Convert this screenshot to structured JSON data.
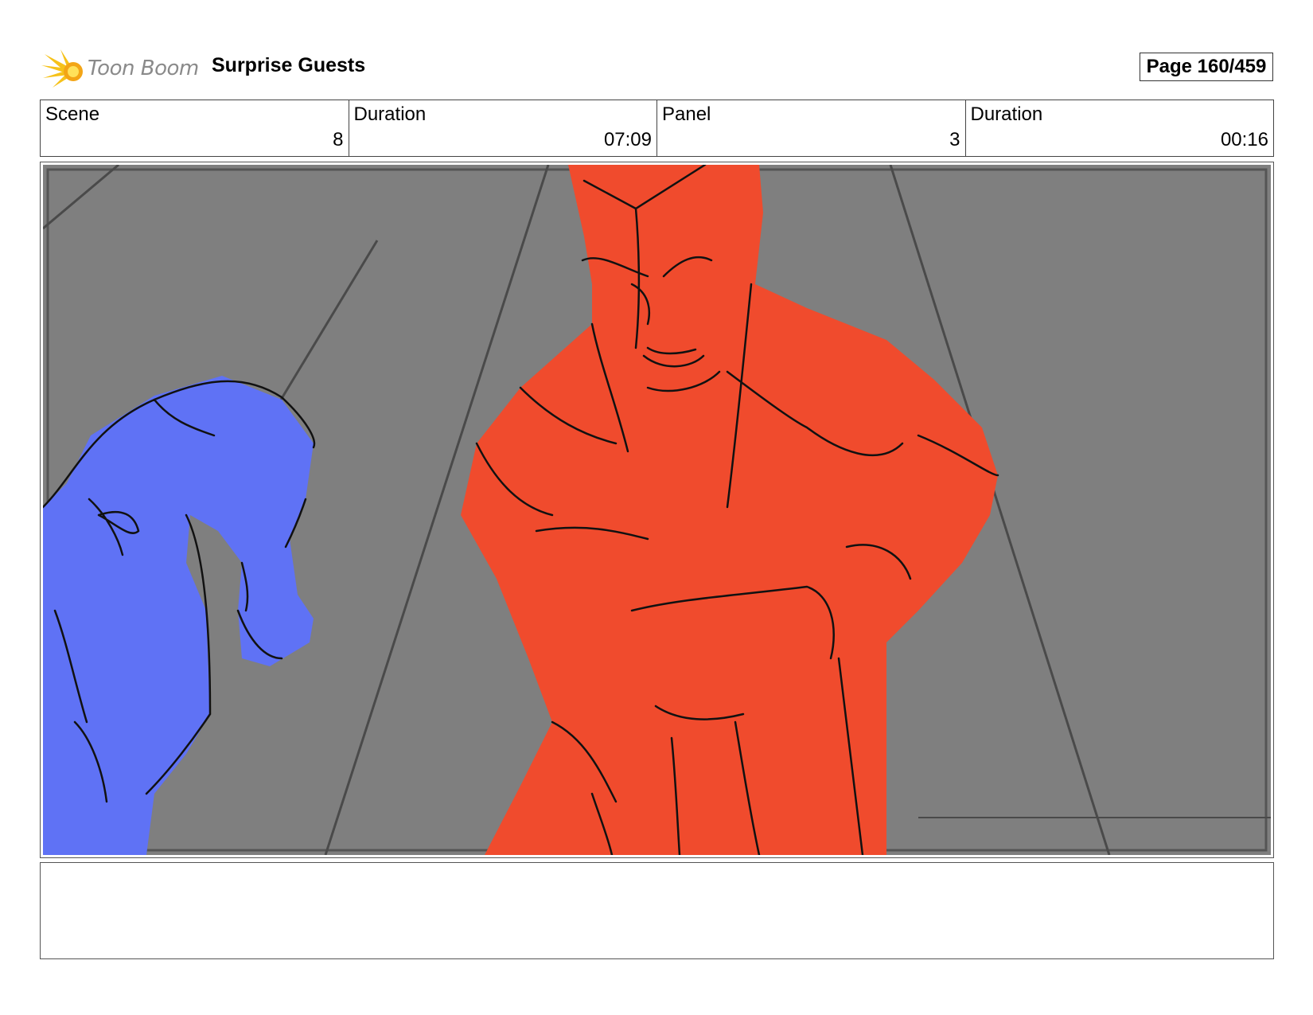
{
  "header": {
    "logo_text": "Toon Boom",
    "title": "Surprise Guests",
    "page": "Page 160/459"
  },
  "info": {
    "scene_label": "Scene",
    "scene_value": "8",
    "scene_duration_label": "Duration",
    "scene_duration_value": "07:09",
    "panel_label": "Panel",
    "panel_value": "3",
    "panel_duration_label": "Duration",
    "panel_duration_value": "00:16"
  },
  "panel_image": {
    "background_color": "#7f7f7f",
    "left_figure_color": "#5f72f5",
    "right_figure_color": "#f04b2d",
    "line_color": "#111111"
  },
  "notes": {
    "text": ""
  }
}
